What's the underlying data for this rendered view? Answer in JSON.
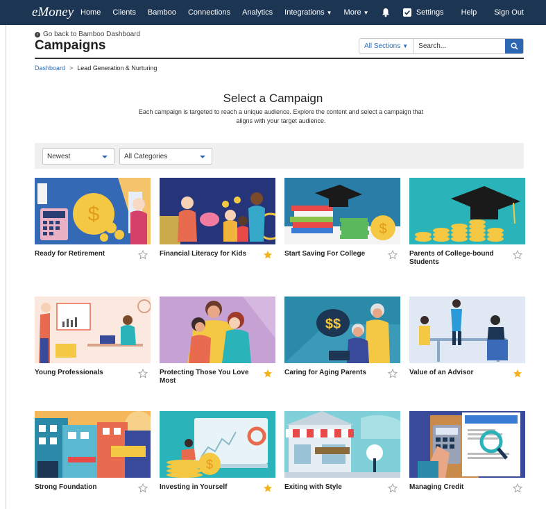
{
  "nav": {
    "logo": "eMoney",
    "links": [
      "Home",
      "Clients",
      "Bamboo",
      "Connections",
      "Analytics",
      "Integrations",
      "More"
    ],
    "right_links": [
      "Settings",
      "Help",
      "Sign Out"
    ]
  },
  "header": {
    "back_link": "Go back to Bamboo Dashboard",
    "title": "Campaigns",
    "sections_label": "All Sections",
    "search_placeholder": "Search..."
  },
  "breadcrumb": {
    "dashboard": "Dashboard",
    "separator": ">",
    "current": "Lead Generation & Nurturing"
  },
  "hero": {
    "title": "Select a Campaign",
    "description": "Each campaign is targeted to reach a unique audience. Explore the content and select a campaign that aligns with your target audience."
  },
  "filters": {
    "sort": "Newest",
    "category": "All Categories"
  },
  "colors": {
    "nav_bg": "#1c3552",
    "accent_blue": "#2e67b1",
    "star_filled": "#f3b31c",
    "star_empty": "#9a9a9a"
  },
  "campaigns": [
    {
      "title": "Ready for Retirement",
      "favorited": false,
      "icon": "retirement-illustration"
    },
    {
      "title": "Financial Literacy for Kids",
      "favorited": true,
      "icon": "family-savings-illustration"
    },
    {
      "title": "Start Saving For College",
      "favorited": false,
      "icon": "graduation-books-illustration"
    },
    {
      "title": "Parents of College-bound Students",
      "favorited": false,
      "icon": "grad-cap-coins-illustration"
    },
    {
      "title": "Young Professionals",
      "favorited": false,
      "icon": "office-presentation-illustration"
    },
    {
      "title": "Protecting Those You Love Most",
      "favorited": true,
      "icon": "family-hug-illustration"
    },
    {
      "title": "Caring for Aging Parents",
      "favorited": false,
      "icon": "elderly-couple-illustration"
    },
    {
      "title": "Value of an Advisor",
      "favorited": true,
      "icon": "advisor-meeting-illustration"
    },
    {
      "title": "Strong Foundation",
      "favorited": false,
      "icon": "family-business-illustration"
    },
    {
      "title": "Investing in Yourself",
      "favorited": true,
      "icon": "investing-screen-illustration"
    },
    {
      "title": "Exiting with Style",
      "favorited": false,
      "icon": "store-for-sale-illustration"
    },
    {
      "title": "Managing Credit",
      "favorited": false,
      "icon": "credit-score-illustration"
    }
  ]
}
